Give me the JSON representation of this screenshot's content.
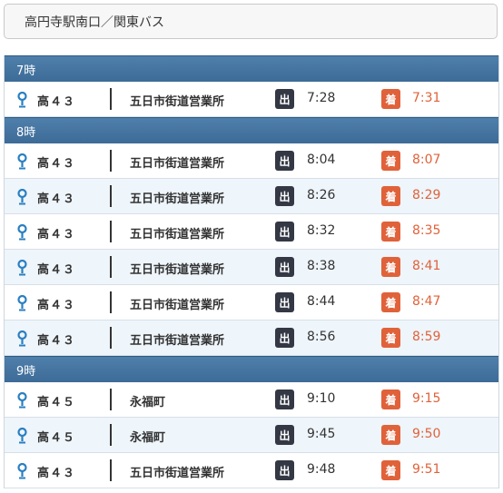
{
  "title": "高円寺駅南口／関東バス",
  "labels": {
    "departure": "出",
    "arrival": "着"
  },
  "colors": {
    "header": "#3d6b97",
    "arrival": "#e0623a",
    "departure_badge": "#333844"
  },
  "icons": {
    "stop": "bus-stop-pin-icon"
  },
  "hours": [
    {
      "label": "7時",
      "rows": [
        {
          "route": "高４３",
          "destination": "五日市街道営業所",
          "depart": "7:28",
          "arrive": "7:31"
        }
      ]
    },
    {
      "label": "8時",
      "rows": [
        {
          "route": "高４３",
          "destination": "五日市街道営業所",
          "depart": "8:04",
          "arrive": "8:07"
        },
        {
          "route": "高４３",
          "destination": "五日市街道営業所",
          "depart": "8:26",
          "arrive": "8:29"
        },
        {
          "route": "高４３",
          "destination": "五日市街道営業所",
          "depart": "8:32",
          "arrive": "8:35"
        },
        {
          "route": "高４３",
          "destination": "五日市街道営業所",
          "depart": "8:38",
          "arrive": "8:41"
        },
        {
          "route": "高４３",
          "destination": "五日市街道営業所",
          "depart": "8:44",
          "arrive": "8:47"
        },
        {
          "route": "高４３",
          "destination": "五日市街道営業所",
          "depart": "8:56",
          "arrive": "8:59"
        }
      ]
    },
    {
      "label": "9時",
      "rows": [
        {
          "route": "高４５",
          "destination": "永福町",
          "depart": "9:10",
          "arrive": "9:15"
        },
        {
          "route": "高４５",
          "destination": "永福町",
          "depart": "9:45",
          "arrive": "9:50"
        },
        {
          "route": "高４３",
          "destination": "五日市街道営業所",
          "depart": "9:48",
          "arrive": "9:51"
        }
      ]
    }
  ]
}
